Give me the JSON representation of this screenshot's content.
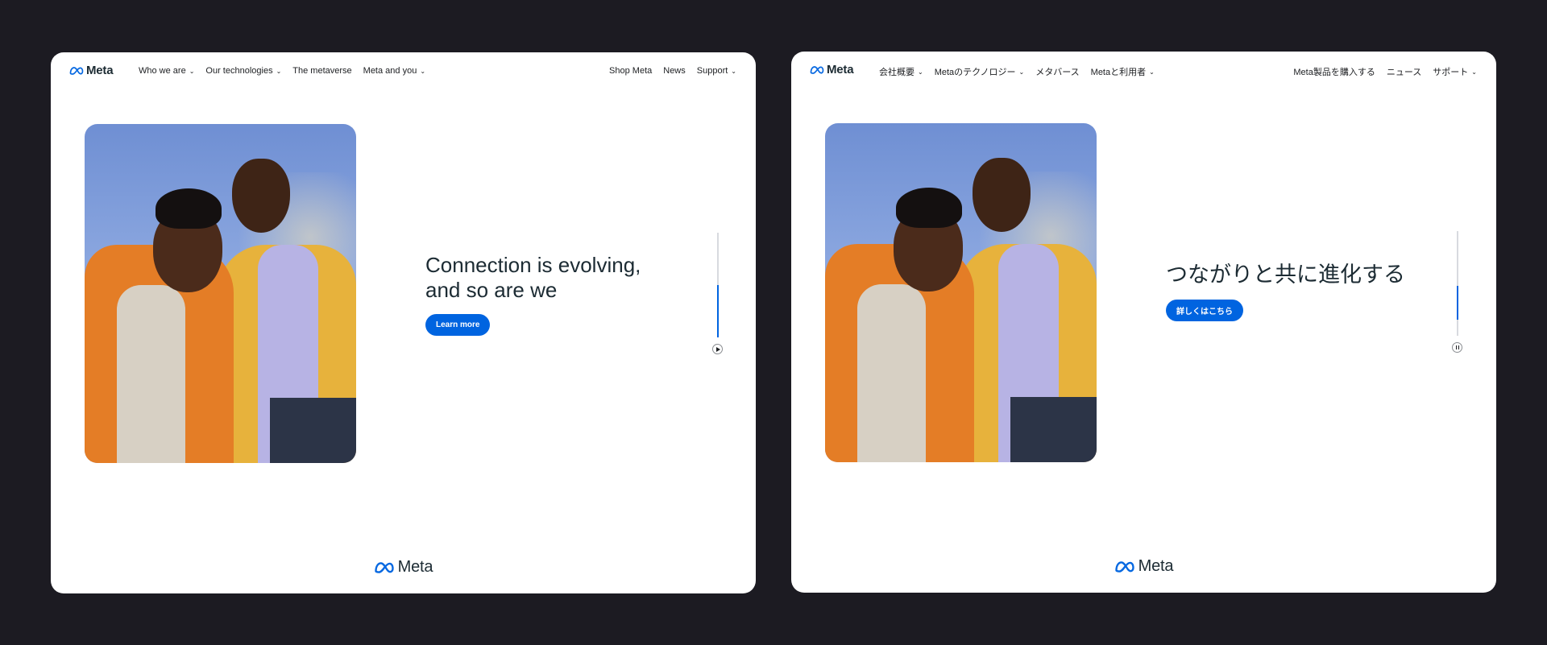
{
  "colors": {
    "accent": "#0064e0",
    "text": "#1c2b33",
    "backdrop": "#1c1b22"
  },
  "en": {
    "logo": "Meta",
    "nav_left": [
      {
        "label": "Who we are",
        "dropdown": true
      },
      {
        "label": "Our technologies",
        "dropdown": true
      },
      {
        "label": "The metaverse",
        "dropdown": false
      },
      {
        "label": "Meta and you",
        "dropdown": true
      }
    ],
    "nav_right": [
      {
        "label": "Shop Meta",
        "dropdown": false
      },
      {
        "label": "News",
        "dropdown": false
      },
      {
        "label": "Support",
        "dropdown": true
      }
    ],
    "headline_line1": "Connection is evolving,",
    "headline_line2": "and so are we",
    "cta": "Learn more",
    "progress": 0.5,
    "media_state": "play-icon",
    "footer_logo": "Meta"
  },
  "ja": {
    "logo": "Meta",
    "nav_left": [
      {
        "label": "会社概要",
        "dropdown": true
      },
      {
        "label": "Metaのテクノロジー",
        "dropdown": true
      },
      {
        "label": "メタバース",
        "dropdown": false
      },
      {
        "label": "Metaと利用者",
        "dropdown": true
      }
    ],
    "nav_right": [
      {
        "label": "Meta製品を購入する",
        "dropdown": false
      },
      {
        "label": "ニュース",
        "dropdown": false
      },
      {
        "label": "サポート",
        "dropdown": true
      }
    ],
    "headline": "つながりと共に進化する",
    "cta": "詳しくはこちら",
    "progress": 0.3,
    "media_state": "pause-icon",
    "footer_logo": "Meta"
  }
}
